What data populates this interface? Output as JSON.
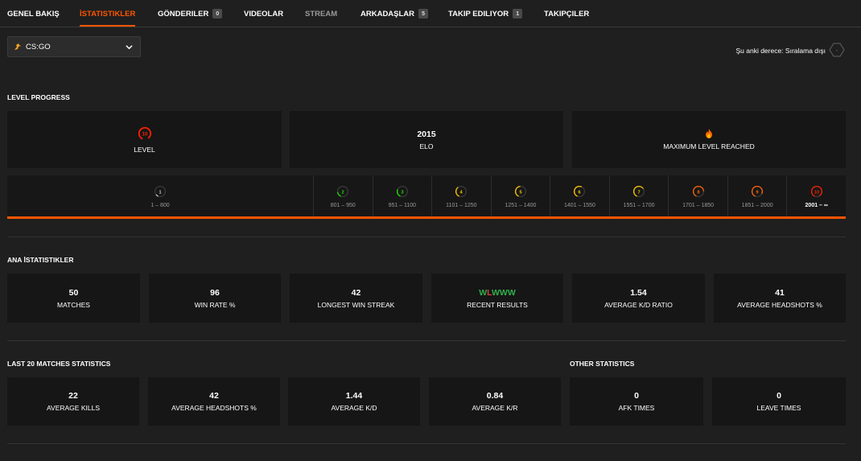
{
  "nav": {
    "tabs": [
      {
        "label": "GENEL BAKIŞ"
      },
      {
        "label": "İSTATISTIKLER",
        "active": true
      },
      {
        "label": "GÖNDERILER",
        "badge": "0"
      },
      {
        "label": "VIDEOLAR"
      },
      {
        "label": "STREAM"
      },
      {
        "label": "ARKADAŞLAR",
        "badge": "5"
      },
      {
        "label": "TAKIP EDILIYOR",
        "badge": "1"
      },
      {
        "label": "TAKIPÇILER"
      }
    ]
  },
  "game_select": {
    "value": "CS:GO",
    "icon": "csgo-logo-icon"
  },
  "rank": {
    "text": "Şu anki derece: Sıralama dışı",
    "value": "-",
    "icon": "rank-hex-icon"
  },
  "level_progress": {
    "title": "LEVEL PROGRESS",
    "cards": [
      {
        "value": "10",
        "label": "LEVEL",
        "icon": "level-10-icon"
      },
      {
        "value": "2015",
        "label": "ELO"
      },
      {
        "value": "",
        "label": "MAXIMUM LEVEL REACHED",
        "icon": "flame-icon"
      }
    ],
    "levels": [
      {
        "level": "1",
        "range": "1 – 800",
        "color": "#cfcfcf"
      },
      {
        "level": "2",
        "range": "801 – 950",
        "color": "#1ce400"
      },
      {
        "level": "3",
        "range": "951 – 1100",
        "color": "#1ce400"
      },
      {
        "level": "4",
        "range": "1101 – 1250",
        "color": "#ffc800"
      },
      {
        "level": "5",
        "range": "1251 – 1400",
        "color": "#ffc800"
      },
      {
        "level": "6",
        "range": "1401 – 1550",
        "color": "#ffc800"
      },
      {
        "level": "7",
        "range": "1551 – 1700",
        "color": "#ffc800"
      },
      {
        "level": "8",
        "range": "1701 – 1850",
        "color": "#ff6309"
      },
      {
        "level": "9",
        "range": "1851 – 2000",
        "color": "#ff6309"
      },
      {
        "level": "10",
        "range": "2001 – ∞",
        "color": "#fe1f00",
        "current": true
      }
    ],
    "progress_fraction": 1.0
  },
  "main_stats": {
    "title": "ANA İSTATISTIKLER",
    "cards": [
      {
        "value": "50",
        "label": "MATCHES"
      },
      {
        "value": "96",
        "label": "WIN RATE %"
      },
      {
        "value": "42",
        "label": "LONGEST WIN STREAK"
      },
      {
        "value": "WLWWW",
        "label": "RECENT RESULTS",
        "results": [
          "W",
          "L",
          "W",
          "W",
          "W"
        ]
      },
      {
        "value": "1.54",
        "label": "AVERAGE K/D RATIO"
      },
      {
        "value": "41",
        "label": "AVERAGE HEADSHOTS %"
      }
    ]
  },
  "last20": {
    "title": "LAST 20 MATCHES STATISTICS",
    "cards": [
      {
        "value": "22",
        "label": "AVERAGE KILLS"
      },
      {
        "value": "42",
        "label": "AVERAGE HEADSHOTS %"
      },
      {
        "value": "1.44",
        "label": "AVERAGE K/D"
      },
      {
        "value": "0.84",
        "label": "AVERAGE K/R"
      }
    ]
  },
  "other": {
    "title": "OTHER STATISTICS",
    "cards": [
      {
        "value": "0",
        "label": "AFK TIMES"
      },
      {
        "value": "0",
        "label": "LEAVE TIMES"
      }
    ]
  },
  "colors": {
    "accent": "#ff5500",
    "win": "#2fb14a",
    "loss": "#e03a3a",
    "card_bg": "#161616"
  }
}
